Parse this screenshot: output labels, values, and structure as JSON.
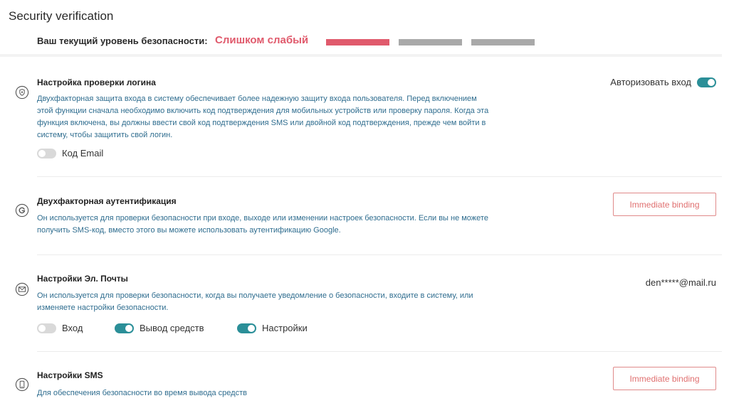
{
  "page": {
    "title": "Security verification"
  },
  "security_level": {
    "label": "Ваш текущий уровень безопасности:",
    "value": "Слишком слабый",
    "level_segments_filled": 1,
    "level_segments_total": 3,
    "colors": {
      "value": "#e05a6c",
      "filled": "#e05a6c",
      "empty": "#a9a9a9"
    }
  },
  "login": {
    "icon": "shield-icon",
    "title": "Настройка проверки логина",
    "description": "Двухфакторная защита входа в систему обеспечивает более надежную защиту входа пользователя. Перед включением этой функции сначала необходимо включить код подтверждения для мобильных устройств или проверку пароля. Когда эта функция включена, вы должны ввести свой код подтверждения SMS или двойной код подтверждения, прежде чем войти в систему, чтобы защитить свой логин.",
    "authorize_label": "Авторизовать вход",
    "authorize_on": true,
    "email_code_label": "Код Email",
    "email_code_on": false
  },
  "twofa": {
    "icon": "google-icon",
    "title": "Двухфакторная аутентификация",
    "description": "Он используется для проверки безопасности при входе, выходе или изменении настроек безопасности. Если вы не можете получить SMS-код, вместо этого вы можете использовать аутентификацию Google.",
    "button_label": "Immediate binding"
  },
  "email": {
    "icon": "mail-icon",
    "title": "Настройки Эл. Почты",
    "description": "Он используется для проверки безопасности, когда вы получаете уведомление о безопасности, входите в систему, или изменяете настройки безопасности.",
    "address": "den*****@mail.ru",
    "toggles": [
      {
        "label": "Вход",
        "on": false
      },
      {
        "label": "Вывод средств",
        "on": true
      },
      {
        "label": "Настройки",
        "on": true
      }
    ]
  },
  "sms": {
    "icon": "phone-icon",
    "title": "Настройки SMS",
    "description": "Для обеспечения безопасности во время вывода средств",
    "button_label": "Immediate binding"
  },
  "colors": {
    "accent": "#2b8f98",
    "link_text": "#2f6d8f",
    "button": "#e07070"
  }
}
